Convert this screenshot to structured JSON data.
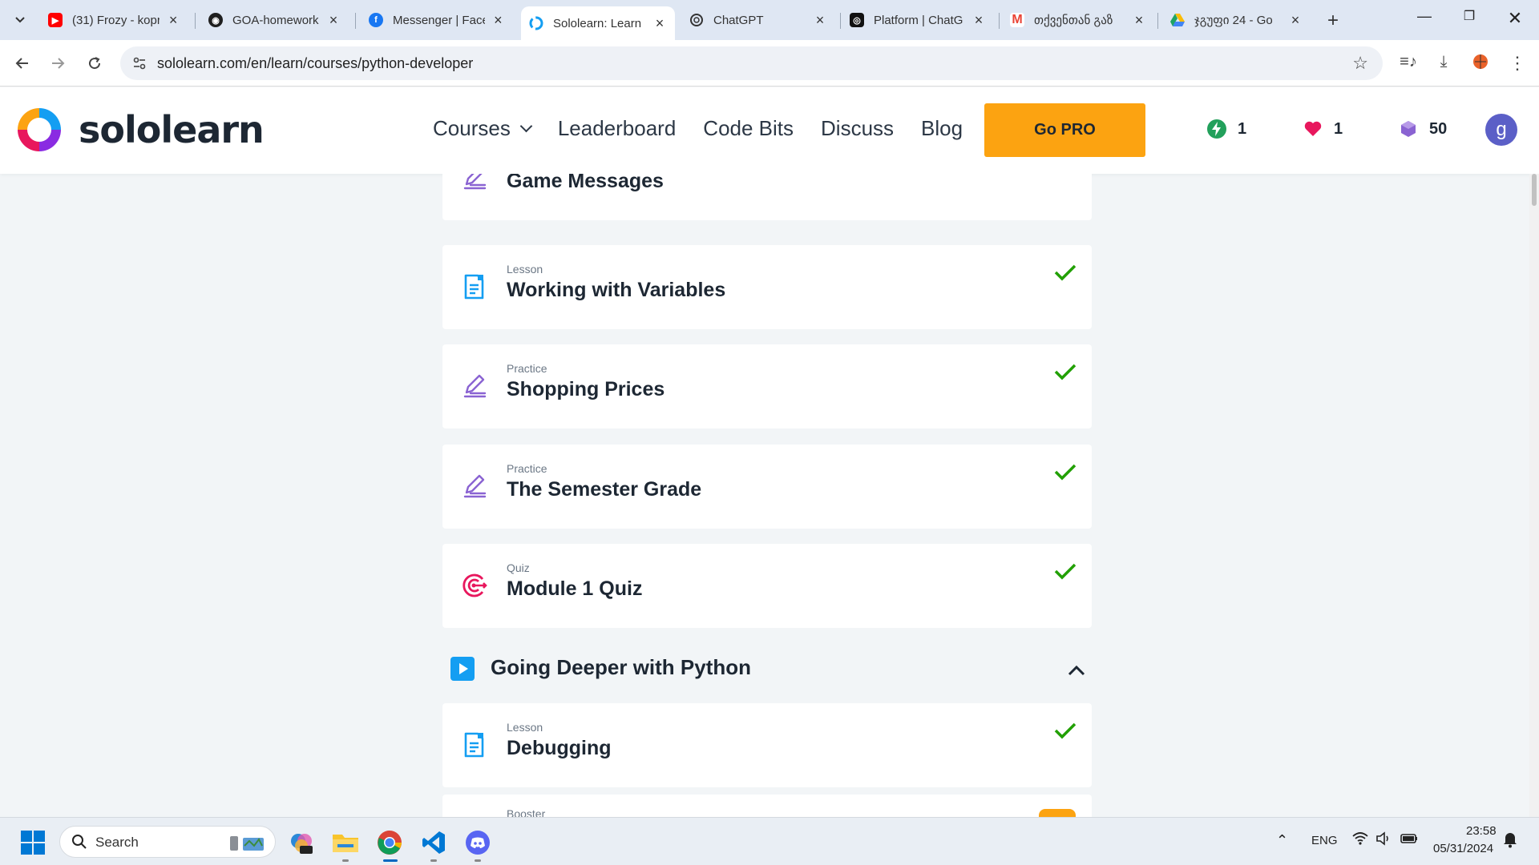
{
  "browser": {
    "tabs": [
      {
        "title": "(31) Frozy - kopr",
        "favicon": "youtube-icon",
        "color": "#ff0000"
      },
      {
        "title": "GOA-homework",
        "favicon": "github-icon",
        "color": "#1f1f1f"
      },
      {
        "title": "Messenger | Face",
        "favicon": "facebook-icon",
        "color": "#1877f2"
      },
      {
        "title": "Sololearn: Learn",
        "favicon": "sololearn-icon",
        "color": "#149ef2",
        "active": true
      },
      {
        "title": "ChatGPT",
        "favicon": "openai-icon",
        "color": "#333333"
      },
      {
        "title": "Platform | ChatG",
        "favicon": "openai-icon",
        "color": "#111111"
      },
      {
        "title": "თქვენთან გაზ",
        "favicon": "gmail-icon",
        "color": "#ea4335"
      },
      {
        "title": "ჯგუფი 24 - Go",
        "favicon": "drive-icon",
        "color": "#1fa463"
      }
    ],
    "url": "sololearn.com/en/learn/courses/python-developer"
  },
  "header": {
    "brand": "sololearn",
    "nav": [
      "Courses",
      "Leaderboard",
      "Code Bits",
      "Discuss",
      "Blog"
    ],
    "cta": "Go PRO",
    "streak": "1",
    "hearts": "1",
    "gems": "50",
    "avatar_letter": "g",
    "colors": {
      "cta": "#fca311",
      "streak": "#22a05b",
      "heart": "#e8175d",
      "gem": "#8a63d2"
    }
  },
  "content": {
    "items": [
      {
        "kind": "",
        "name": "Game Messages",
        "type": "practice",
        "completed": true
      },
      {
        "kind": "Lesson",
        "name": "Working with Variables",
        "type": "lesson",
        "completed": true
      },
      {
        "kind": "Practice",
        "name": "Shopping Prices",
        "type": "practice",
        "completed": true
      },
      {
        "kind": "Practice",
        "name": "The Semester Grade",
        "type": "practice",
        "completed": true
      },
      {
        "kind": "Quiz",
        "name": "Module 1 Quiz",
        "type": "quiz",
        "completed": true
      }
    ],
    "module": {
      "title": "Going Deeper with Python"
    },
    "items2": [
      {
        "kind": "Lesson",
        "name": "Debugging",
        "type": "lesson",
        "completed": true
      },
      {
        "kind": "Booster",
        "name": "",
        "type": "booster",
        "completed": false
      }
    ]
  },
  "taskbar": {
    "search_label": "Search",
    "language": "ENG",
    "time": "23:58",
    "date": "05/31/2024"
  }
}
